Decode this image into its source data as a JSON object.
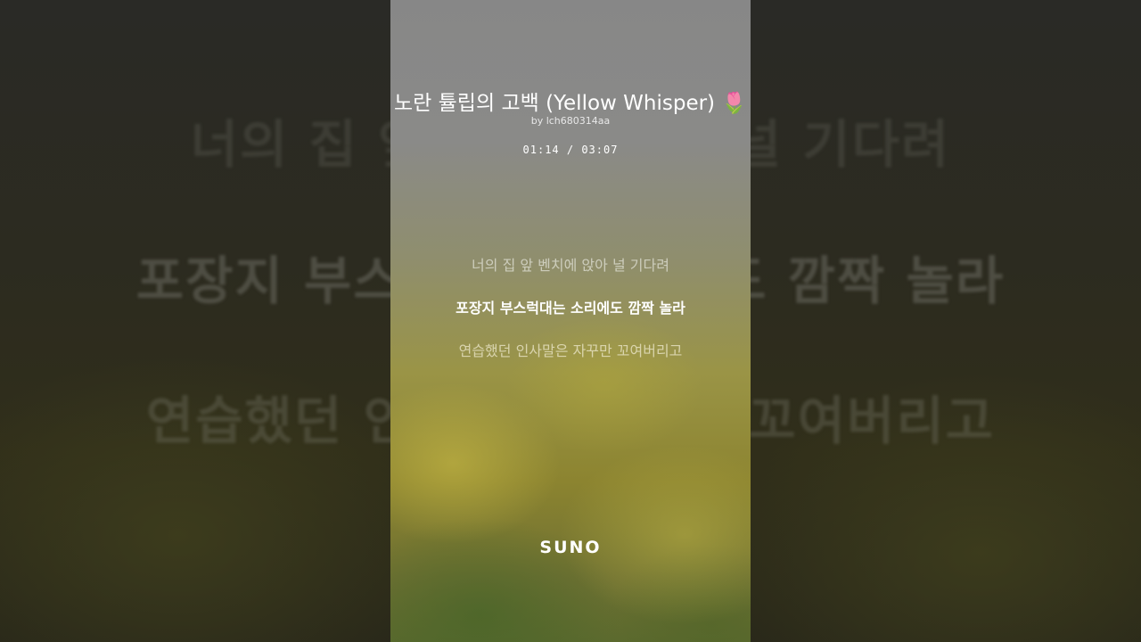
{
  "song": {
    "title": "노란 튤립의 고백 (Yellow Whisper) 🌷",
    "author": "by lch680314aa",
    "time": "01:14 / 03:07"
  },
  "lyrics": {
    "previous": "너의 집 앞 벤치에 앉아 널 기다려",
    "current": "포장지 부스럭대는 소리에도 깜짝 놀라",
    "next": "연습했던 인사말은 자꾸만 꼬여버리고"
  },
  "brand": {
    "logo": "SUNO"
  }
}
